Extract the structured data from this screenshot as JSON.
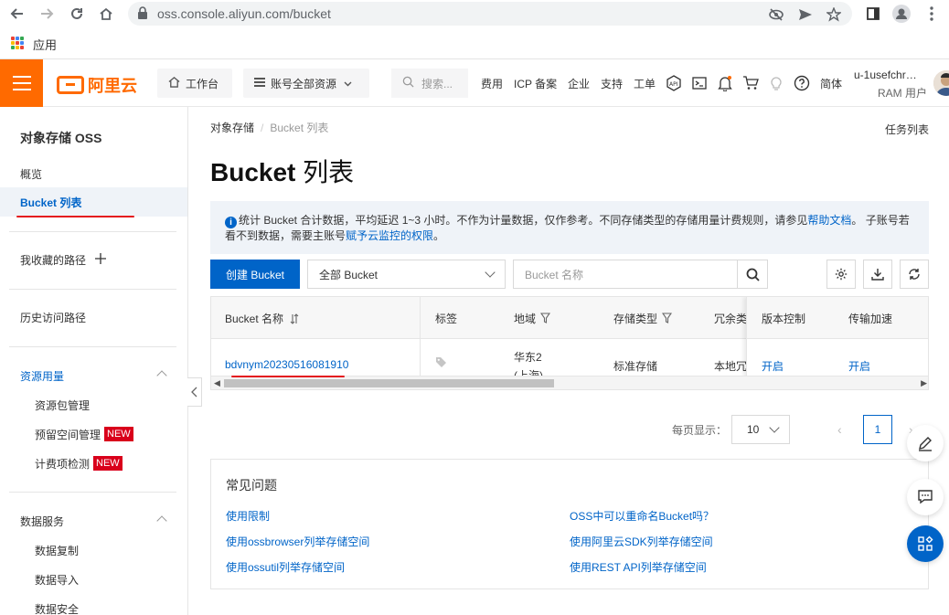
{
  "browser": {
    "url": "oss.console.aliyun.com/bucket",
    "bookmarks_label": "应用"
  },
  "topbar": {
    "logo_text": "阿里云",
    "workbench": "工作台",
    "resources": "账号全部资源",
    "search_placeholder": "搜索...",
    "links": [
      "费用",
      "ICP 备案",
      "企业",
      "支持",
      "工单"
    ],
    "lang": "简体",
    "user_name": "u-1usefchr…",
    "user_role": "RAM 用户"
  },
  "sidebar": {
    "title": "对象存储 OSS",
    "overview": "概览",
    "bucket_list": "Bucket 列表",
    "favorites": "我收藏的路径",
    "history": "历史访问路径",
    "resource_usage": "资源用量",
    "resource_items": [
      "资源包管理",
      "预留空间管理",
      "计费项检测"
    ],
    "new_badge": "NEW",
    "data_services": "数据服务",
    "data_items": [
      "数据复制",
      "数据导入",
      "数据安全"
    ]
  },
  "main": {
    "crumb_root": "对象存储",
    "crumb_current": "Bucket 列表",
    "task_list": "任务列表",
    "title_bold": "Bucket",
    "title_rest": " 列表",
    "notice_1": "统计 Bucket 合计数据，平均延迟 1~3 小时。不作为计量数据，仅作参考。不同存储类型的存储用量计费规则，请参见",
    "notice_link1": "帮助文档",
    "notice_2": "。 子账号若看不到数据，需要主账号",
    "notice_link2": "赋予云监控的权限",
    "notice_3": "。",
    "create_button": "创建 Bucket",
    "filter_select": "全部 Bucket",
    "search_placeholder": "Bucket 名称"
  },
  "table": {
    "headers": {
      "name": "Bucket 名称",
      "tag": "标签",
      "region": "地域",
      "storage_class": "存储类型",
      "redundancy": "冗余类",
      "versioning": "版本控制",
      "acceleration": "传输加速"
    },
    "rows": [
      {
        "name": "bdvnym20230516081910",
        "region_line1": "华东2",
        "region_line2": "(上海)",
        "storage_class": "标准存储",
        "redundancy": "本地冗",
        "versioning": "开启",
        "acceleration": "开启"
      }
    ]
  },
  "pagination": {
    "label": "每页显示：",
    "page_size": "10",
    "current_page": "1"
  },
  "faq": {
    "title": "常见问题",
    "left": [
      "使用限制",
      "使用ossbrowser列举存储空间",
      "使用ossutil列举存储空间"
    ],
    "right": [
      "OSS中可以重命名Bucket吗？",
      "使用阿里云SDK列举存储空间",
      "使用REST API列举存储空间"
    ]
  },
  "colors": {
    "brand_orange": "#ff6a00",
    "primary_blue": "#0064c8",
    "annotation_red": "#e4181e"
  }
}
